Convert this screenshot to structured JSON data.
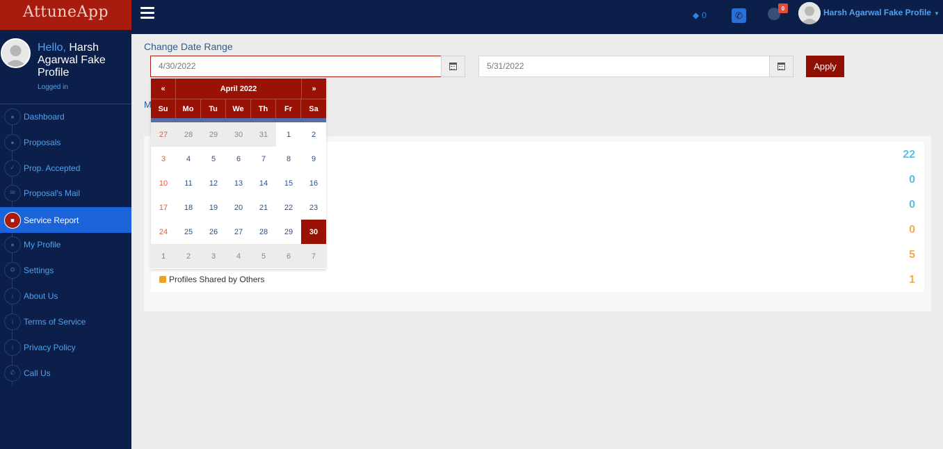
{
  "header": {
    "logo_text": "AttuneApp",
    "gem_count": "0",
    "notification_count": "0",
    "user_name": "Harsh Agarwal Fake Profile"
  },
  "sidebar": {
    "hello": "Hello,",
    "name": "Harsh Agarwal Fake Profile",
    "status": "Logged in",
    "items": [
      {
        "label": "Dashboard"
      },
      {
        "label": "Proposals"
      },
      {
        "label": "Prop. Accepted"
      },
      {
        "label": "Proposal's Mail"
      },
      {
        "label": "Service Report",
        "active": true
      },
      {
        "label": "My Profile"
      },
      {
        "label": "Settings"
      },
      {
        "label": "About Us"
      },
      {
        "label": "Terms of Service"
      },
      {
        "label": "Privacy Policy"
      },
      {
        "label": "Call Us"
      }
    ]
  },
  "main": {
    "title": "Change Date Range",
    "start_date": "4/30/2022",
    "end_date": "5/31/2022",
    "apply_label": "Apply",
    "peek_letter": "M",
    "counts": [
      {
        "value": "22",
        "color": "#5bc0de"
      },
      {
        "value": "0",
        "color": "#5bc0de"
      },
      {
        "value": "0",
        "color": "#5bc0de"
      },
      {
        "value": "0",
        "color": "#f0ad4e"
      },
      {
        "value": "5",
        "color": "#f0ad4e"
      },
      {
        "value": "1",
        "color": "#f0ad4e"
      }
    ],
    "shared_label": "Profiles Shared by Others"
  },
  "datepicker": {
    "prev": "«",
    "next": "»",
    "title": "April 2022",
    "days_of_week": [
      "Su",
      "Mo",
      "Tu",
      "We",
      "Th",
      "Fr",
      "Sa"
    ],
    "weeks": [
      [
        "27",
        "28",
        "29",
        "30",
        "31",
        "1",
        "2"
      ],
      [
        "3",
        "4",
        "5",
        "6",
        "7",
        "8",
        "9"
      ],
      [
        "10",
        "11",
        "12",
        "13",
        "14",
        "15",
        "16"
      ],
      [
        "17",
        "18",
        "19",
        "20",
        "21",
        "22",
        "23"
      ],
      [
        "24",
        "25",
        "26",
        "27",
        "28",
        "29",
        "30"
      ],
      [
        "1",
        "2",
        "3",
        "4",
        "5",
        "6",
        "7"
      ]
    ],
    "selected": "30"
  }
}
